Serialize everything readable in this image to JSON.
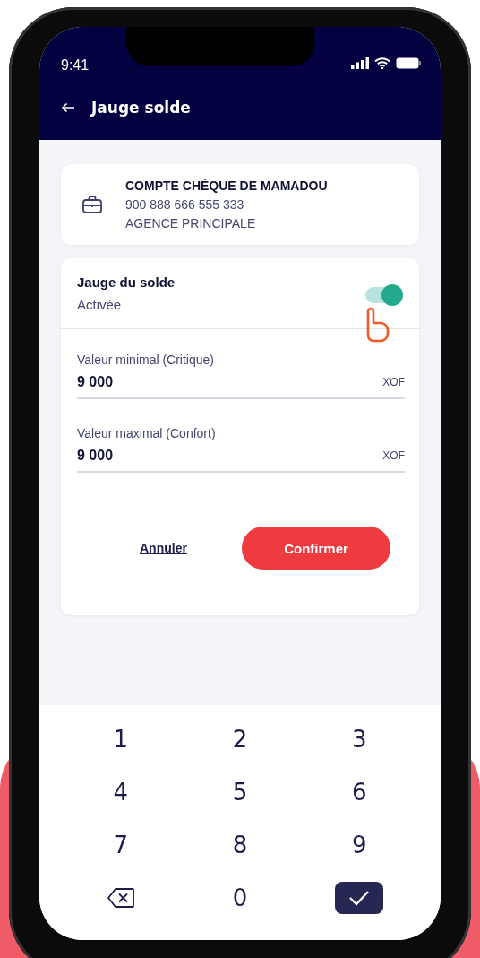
{
  "status_bar": {
    "time": "9:41"
  },
  "header": {
    "title": "Jauge solde"
  },
  "account": {
    "name": "COMPTE CHÈQUE DE MAMADOU",
    "number": "900 888 666 555 333",
    "agency": "AGENCE PRINCIPALE"
  },
  "gauge": {
    "title": "Jauge du solde",
    "status": "Activée",
    "on": true
  },
  "fields": [
    {
      "label": "Valeur minimal (Critique)",
      "value": "9 000",
      "unit": "XOF"
    },
    {
      "label": "Valeur maximal (Confort)",
      "value": "9 000",
      "unit": "XOF"
    }
  ],
  "actions": {
    "cancel": "Annuler",
    "confirm": "Confirmer"
  },
  "keypad": [
    {
      "kind": "digit",
      "label": "1"
    },
    {
      "kind": "digit",
      "label": "2"
    },
    {
      "kind": "digit",
      "label": "3"
    },
    {
      "kind": "digit",
      "label": "4"
    },
    {
      "kind": "digit",
      "label": "5"
    },
    {
      "kind": "digit",
      "label": "6"
    },
    {
      "kind": "digit",
      "label": "7"
    },
    {
      "kind": "digit",
      "label": "8"
    },
    {
      "kind": "digit",
      "label": "9"
    },
    {
      "kind": "delete"
    },
    {
      "kind": "digit",
      "label": "0"
    },
    {
      "kind": "confirm"
    }
  ]
}
